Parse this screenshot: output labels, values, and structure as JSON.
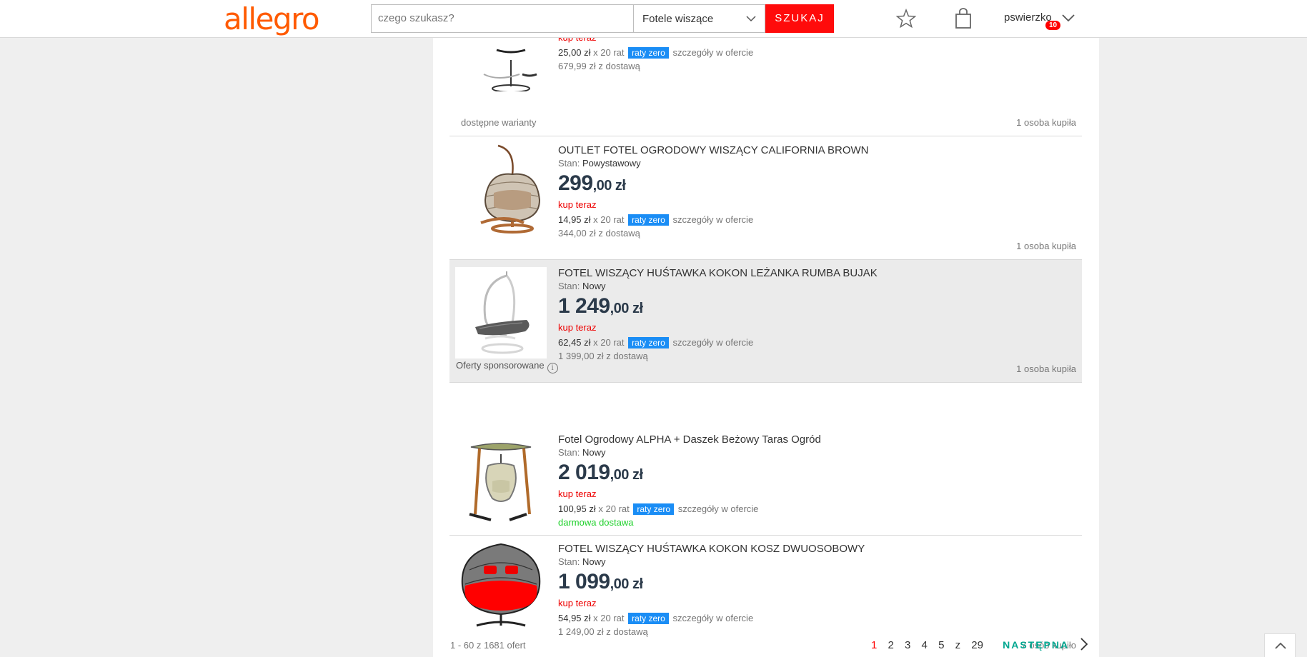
{
  "header": {
    "logo": "allegro",
    "search_placeholder": "czego szukasz?",
    "category": "Fotele wiszące",
    "search_button": "SZUKAJ",
    "username": "pswierzko",
    "notification_count": "10"
  },
  "listings": [
    {
      "title": "",
      "kup": "kup teraz",
      "raty_amount": "25,00 zł",
      "raty_count": "x 20 rat",
      "raty_badge": "raty zero",
      "raty_details": "szczegóły w ofercie",
      "delivery": "679,99 zł z dostawą",
      "variants": "dostępne warianty",
      "bought": "1 osoba kupiła"
    },
    {
      "title": "OUTLET FOTEL OGRODOWY WISZĄCY CALIFORNIA BROWN",
      "stan_label": "Stan:",
      "stan_value": "Powystawowy",
      "price_main": "299",
      "price_fraction": ",00 zł",
      "kup": "kup teraz",
      "raty_amount": "14,95 zł",
      "raty_count": "x 20 rat",
      "raty_badge": "raty zero",
      "raty_details": "szczegóły w ofercie",
      "delivery": "344,00 zł z dostawą",
      "bought": "1 osoba kupiła"
    },
    {
      "title": "FOTEL WISZĄCY HUŚTAWKA KOKON LEŻANKA RUMBA BUJAK",
      "stan_label": "Stan:",
      "stan_value": "Nowy",
      "price_main": "1 249",
      "price_fraction": ",00 zł",
      "kup": "kup teraz",
      "raty_amount": "62,45 zł",
      "raty_count": "x 20 rat",
      "raty_badge": "raty zero",
      "raty_details": "szczegóły w ofercie",
      "delivery": "1 399,00 zł z dostawą",
      "bought": "1 osoba kupiła"
    }
  ],
  "sponsored_label": "Oferty sponsorowane",
  "sponsored": [
    {
      "title": "Fotel Ogrodowy ALPHA + Daszek Beżowy Taras Ogród",
      "stan_label": "Stan:",
      "stan_value": "Nowy",
      "price_main": "2 019",
      "price_fraction": ",00 zł",
      "kup": "kup teraz",
      "raty_amount": "100,95 zł",
      "raty_count": "x 20 rat",
      "raty_badge": "raty zero",
      "raty_details": "szczegóły w ofercie",
      "delivery": "darmowa dostawa"
    },
    {
      "title": "FOTEL WISZĄCY HUŚTAWKA KOKON KOSZ DWUOSOBOWY",
      "stan_label": "Stan:",
      "stan_value": "Nowy",
      "price_main": "1 099",
      "price_fraction": ",00 zł",
      "kup": "kup teraz",
      "raty_amount": "54,95 zł",
      "raty_count": "x 20 rat",
      "raty_badge": "raty zero",
      "raty_details": "szczegóły w ofercie",
      "delivery": "1 249,00 zł z dostawą",
      "bought": "7 osób kupiło"
    }
  ],
  "pagination": {
    "range": "1 - 60 z 1681 ofert",
    "pages": [
      "1",
      "2",
      "3",
      "4",
      "5"
    ],
    "of": "z",
    "total": "29",
    "next": "NASTĘPNA"
  },
  "colors": {
    "brand": "#ff5a00",
    "search_button": "#ff0b0b",
    "raty_badge": "#1a8df5",
    "next_link": "#00a790",
    "free_delivery": "#1ed02a"
  }
}
